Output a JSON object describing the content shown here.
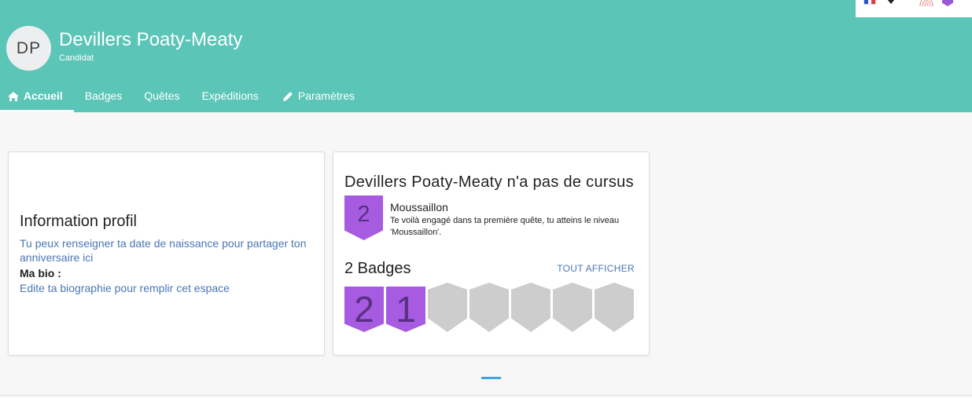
{
  "header": {
    "avatar_initials": "DP",
    "name": "Devillers Poaty-Meaty",
    "role": "Candidat",
    "background_color": "#5bc5b8"
  },
  "topbar": {
    "language_icon": "france-flag-icon",
    "dropdown_icon": "caret-down-icon",
    "fingerprint_icon": "fingerprint-icon",
    "badge_icon": "purple-badge-icon"
  },
  "nav": {
    "items": [
      {
        "label": "Accueil",
        "icon": "home-icon",
        "active": true
      },
      {
        "label": "Badges"
      },
      {
        "label": "Quêtes"
      },
      {
        "label": "Expéditions"
      },
      {
        "label": "Paramètres",
        "icon": "pencil-icon"
      }
    ]
  },
  "profile_card": {
    "title": "Information profil",
    "birthday_prompt": "Tu peux renseigner ta date de naissance pour partager ton anniversaire ici",
    "bio_label": "Ma bio :",
    "bio_prompt": "Edite ta biographie pour remplir cet espace"
  },
  "progress_card": {
    "title": "Devillers Poaty-Meaty n'a pas de cursus",
    "level_number": "2",
    "level_name": "Moussaillon",
    "level_description": "Te voilà engagé dans ta première quête, tu atteins le niveau 'Moussaillon'.",
    "badges_count_label": "2 Badges",
    "show_all_label": "TOUT AFFICHER",
    "badges": [
      {
        "value": "2",
        "earned": true
      },
      {
        "value": "1",
        "earned": true
      },
      {
        "value": "",
        "earned": false
      },
      {
        "value": "",
        "earned": false
      },
      {
        "value": "",
        "earned": false
      },
      {
        "value": "",
        "earned": false
      },
      {
        "value": "",
        "earned": false
      }
    ],
    "badge_color": "#a65be0",
    "empty_badge_color": "#cdcdcd"
  },
  "carousel": {
    "indicator_color": "#3aa8dd"
  }
}
